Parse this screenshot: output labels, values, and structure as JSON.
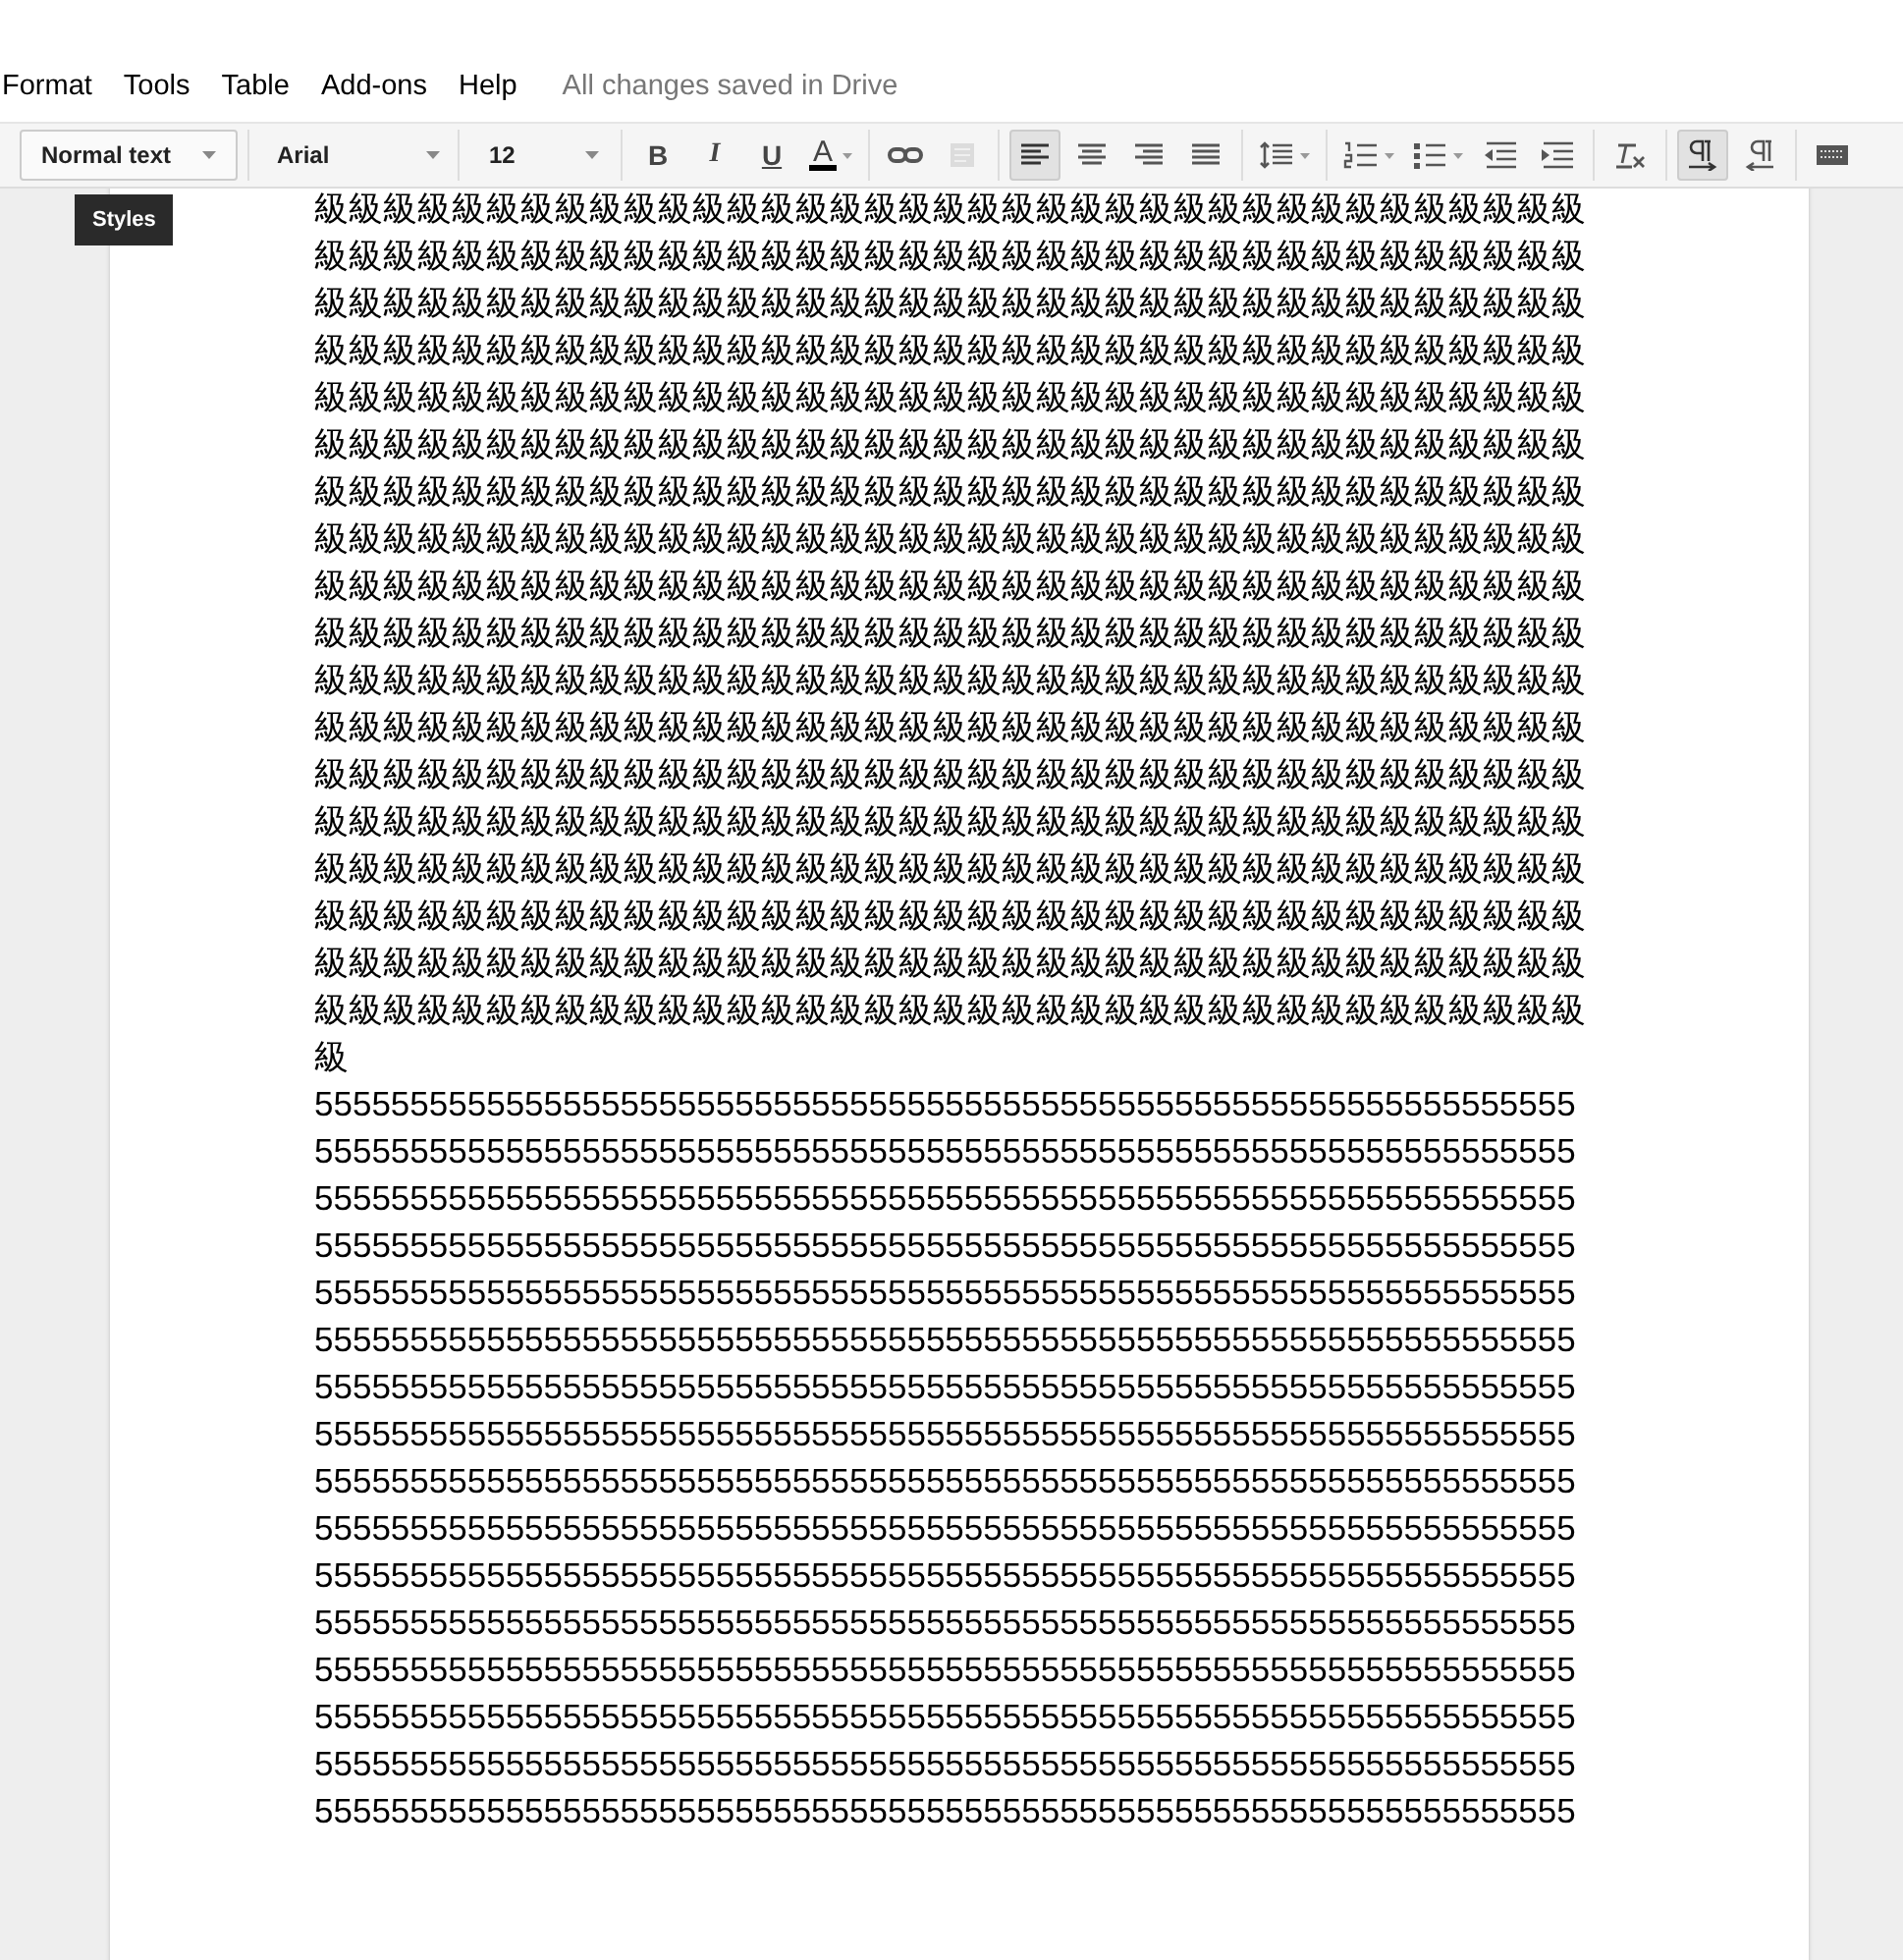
{
  "menu": [
    "Format",
    "Tools",
    "Table",
    "Add-ons",
    "Help"
  ],
  "save_status": "All changes saved in Drive",
  "toolbar": {
    "style": "Normal text",
    "font": "Arial",
    "size": "12",
    "tooltip": "Styles",
    "groups": [
      [
        {
          "kind": "bold",
          "label": "B",
          "selected": false
        },
        {
          "kind": "italic",
          "label": "I",
          "selected": false
        },
        {
          "kind": "underline",
          "label": "U",
          "selected": false
        },
        {
          "kind": "color",
          "label": "A",
          "selected": false
        }
      ],
      [
        {
          "kind": "link",
          "selected": false
        },
        {
          "kind": "comment",
          "selected": false,
          "disabled": true
        }
      ],
      [
        {
          "kind": "align-left",
          "selected": true
        },
        {
          "kind": "align-center",
          "selected": false
        },
        {
          "kind": "align-right",
          "selected": false
        },
        {
          "kind": "justify",
          "selected": false
        }
      ],
      [
        {
          "kind": "line-spacing",
          "selected": false
        }
      ],
      [
        {
          "kind": "numbered-list",
          "selected": false
        },
        {
          "kind": "bulleted-list",
          "selected": false
        },
        {
          "kind": "outdent",
          "selected": false
        },
        {
          "kind": "indent",
          "selected": false
        }
      ],
      [
        {
          "kind": "clear-format",
          "selected": false
        }
      ],
      [
        {
          "kind": "ltr",
          "selected": true
        },
        {
          "kind": "rtl",
          "selected": false
        }
      ],
      [
        {
          "kind": "keyboard",
          "selected": false
        }
      ]
    ]
  },
  "document": {
    "paragraphs": [
      {
        "lines": [
          "級級級級級級級級級級級級級級級級級級級級級級級級級級級級級級級級級級級級級",
          "級級級級級級級級級級級級級級級級級級級級級級級級級級級級級級級級級級級級級",
          "級級級級級級級級級級級級級級級級級級級級級級級級級級級級級級級級級級級級級",
          "級級級級級級級級級級級級級級級級級級級級級級級級級級級級級級級級級級級級級",
          "級級級級級級級級級級級級級級級級級級級級級級級級級級級級級級級級級級級級級",
          "級級級級級級級級級級級級級級級級級級級級級級級級級級級級級級級級級級級級級",
          "級級級級級級級級級級級級級級級級級級級級級級級級級級級級級級級級級級級級級",
          "級級級級級級級級級級級級級級級級級級級級級級級級級級級級級級級級級級級級級",
          "級級級級級級級級級級級級級級級級級級級級級級級級級級級級級級級級級級級級級",
          "級級級級級級級級級級級級級級級級級級級級級級級級級級級級級級級級級級級級級",
          "級級級級級級級級級級級級級級級級級級級級級級級級級級級級級級級級級級級級級",
          "級級級級級級級級級級級級級級級級級級級級級級級級級級級級級級級級級級級級級",
          "級級級級級級級級級級級級級級級級級級級級級級級級級級級級級級級級級級級級級",
          "級級級級級級級級級級級級級級級級級級級級級級級級級級級級級級級級級級級級級",
          "級級級級級級級級級級級級級級級級級級級級級級級級級級級級級級級級級級級級級",
          "級級級級級級級級級級級級級級級級級級級級級級級級級級級級級級級級級級級級級",
          "級級級級級級級級級級級級級級級級級級級級級級級級級級級級級級級級級級級級級",
          "級級級級級級級級級級級級級級級級級級級級級級級級級級級級級級級級級級級級級",
          "級"
        ]
      },
      {
        "lines": [
          "555555555555555555555555555555555555555555555555555555555555555555",
          "555555555555555555555555555555555555555555555555555555555555555555",
          "555555555555555555555555555555555555555555555555555555555555555555",
          "555555555555555555555555555555555555555555555555555555555555555555",
          "555555555555555555555555555555555555555555555555555555555555555555",
          "555555555555555555555555555555555555555555555555555555555555555555",
          "555555555555555555555555555555555555555555555555555555555555555555",
          "555555555555555555555555555555555555555555555555555555555555555555",
          "555555555555555555555555555555555555555555555555555555555555555555",
          "555555555555555555555555555555555555555555555555555555555555555555",
          "555555555555555555555555555555555555555555555555555555555555555555",
          "555555555555555555555555555555555555555555555555555555555555555555",
          "555555555555555555555555555555555555555555555555555555555555555555",
          "555555555555555555555555555555555555555555555555555555555555555555",
          "555555555555555555555555555555555555555555555555555555555555555555",
          "555555555555555555555555555555555555555555555555555555555555555555"
        ]
      }
    ]
  }
}
